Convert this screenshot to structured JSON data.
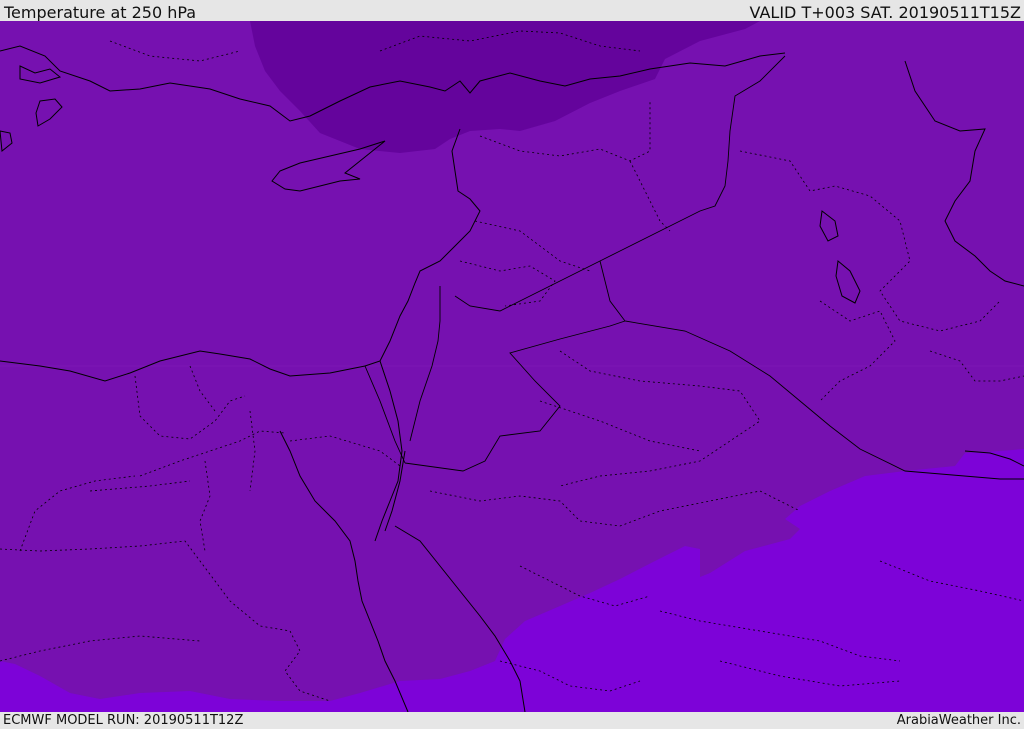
{
  "header": {
    "title": "Temperature at 250 hPa",
    "valid": "VALID T+003 SAT. 20190511T15Z"
  },
  "footer": {
    "model_run": "ECMWF MODEL RUN: 20190511T12Z",
    "provider": "ArabiaWeather Inc."
  },
  "colors": {
    "band_cold": "#64049c",
    "band_mid": "#7611b0",
    "band_warm": "#7d03d8",
    "coastline": "#000000",
    "header_bg": "#e6e6e6"
  }
}
